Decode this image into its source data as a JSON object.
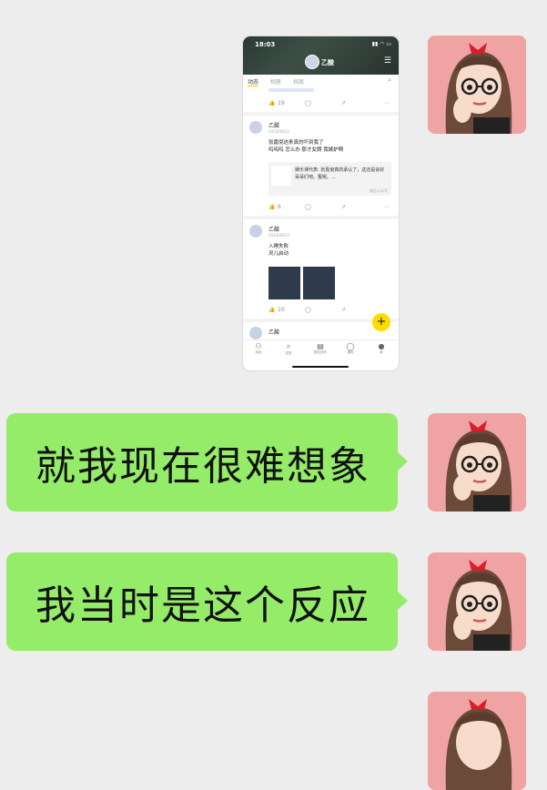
{
  "messages": [
    {
      "type": "image"
    },
    {
      "type": "text",
      "text": "就我现在很难想象"
    },
    {
      "type": "text",
      "text": "我当时是这个反应"
    },
    {
      "type": "avatar-only"
    }
  ],
  "embedded_screenshot": {
    "status_time": "18:03",
    "profile_name": "乙酸",
    "tabs": [
      "动态",
      "相册",
      "档案"
    ],
    "posts": [
      {
        "likes": "19"
      },
      {
        "author": "乙酸",
        "date": "2023/09/22",
        "lines": [
          "张嘉倪这条真的吓到我了",
          "呜呜呜 怎么办 那才女朗 我嫉妒啊"
        ],
        "share_text": "娱乐课代表: 张嘉倪真的承认了，这还是会好哥哥们吧。冤呢。…",
        "share_source": "微信公众号",
        "likes": "6"
      },
      {
        "author": "乙酸",
        "date": "2023/09/22",
        "lines": [
          "入睡失败",
          "灵儿启动"
        ],
        "likes": "10"
      },
      {
        "author": "乙酸"
      }
    ],
    "nav": [
      "动态",
      "发现",
      "图文创作",
      "通知",
      "我"
    ],
    "fab": "+"
  },
  "colors": {
    "bubble": "#95ec69",
    "background": "#ededed",
    "fab": "#ffdc00"
  }
}
